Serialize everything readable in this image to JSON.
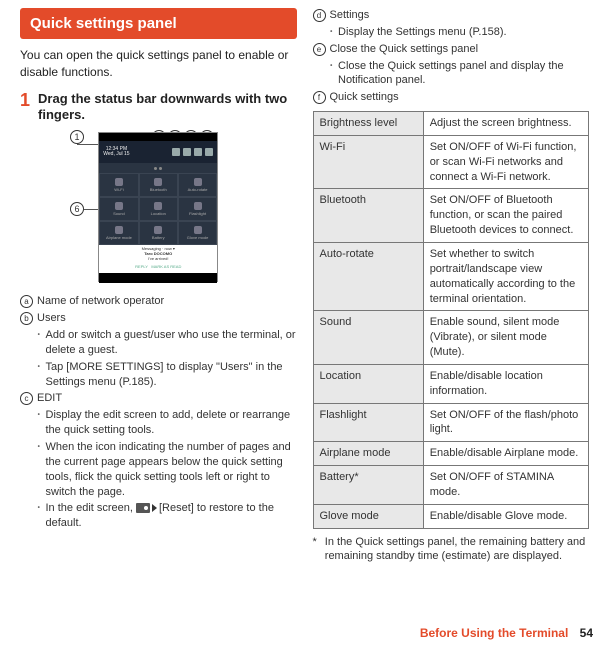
{
  "header": {
    "title": "Quick settings panel"
  },
  "intro": "You can open the quick settings panel to enable or disable functions.",
  "step": {
    "num": "1",
    "text": "Drag the status bar downwards with two fingers."
  },
  "screenshot": {
    "time": "12:34 PM",
    "date": "Wed, Jul 15",
    "tiles": [
      "Wi-Fi",
      "Bluetooth",
      "Auto-rotate",
      "Sound",
      "Location",
      "Flashlight",
      "Airplane mode",
      "Battery",
      "Glove mode"
    ],
    "notif_app": "Messaging · now ▾",
    "notif_sender": "Taro DOCOMO",
    "notif_body": "I've arrived!",
    "notif_reply": "REPLY",
    "notif_mark": "MARK AS READ"
  },
  "callouts": {
    "c1": "1",
    "c2": "2",
    "c3": "3",
    "c4": "4",
    "c5": "5",
    "c6": "6"
  },
  "leftList": {
    "i1": {
      "num": "a",
      "text": "Name of network operator"
    },
    "i2": {
      "num": "b",
      "text": "Users",
      "subs": [
        "Add or switch a guest/user who use the terminal, or delete a guest.",
        "Tap [MORE SETTINGS] to display \"Users\" in the Settings menu (P.185)."
      ]
    },
    "i3": {
      "num": "c",
      "text": "EDIT",
      "subs": [
        "Display the edit screen to add, delete or rearrange the quick setting tools.",
        "When the icon indicating the number of pages and the current page appears below the quick setting tools, flick the quick setting tools left or right to switch the page.",
        "In the edit screen,  [Reset] to restore to the default."
      ]
    }
  },
  "rightList": {
    "i4": {
      "num": "d",
      "text": "Settings",
      "subs": [
        "Display the Settings menu (P.158)."
      ]
    },
    "i5": {
      "num": "e",
      "text": "Close the Quick settings panel",
      "subs": [
        "Close the Quick settings panel and display the Notification panel."
      ]
    },
    "i6": {
      "num": "f",
      "text": "Quick settings"
    }
  },
  "table": [
    {
      "label": "Brightness level",
      "desc": "Adjust the screen brightness."
    },
    {
      "label": "Wi-Fi",
      "desc": "Set ON/OFF of Wi-Fi function, or scan Wi-Fi networks and connect a Wi-Fi network."
    },
    {
      "label": "Bluetooth",
      "desc": "Set ON/OFF of Bluetooth function, or scan the paired Bluetooth devices to connect."
    },
    {
      "label": "Auto-rotate",
      "desc": "Set whether to switch portrait/landscape view automatically according to the terminal orientation."
    },
    {
      "label": "Sound",
      "desc": "Enable sound, silent mode (Vibrate), or silent mode (Mute)."
    },
    {
      "label": "Location",
      "desc": "Enable/disable location information."
    },
    {
      "label": "Flashlight",
      "desc": "Set ON/OFF of the flash/photo light."
    },
    {
      "label": "Airplane mode",
      "desc": "Enable/disable Airplane mode."
    },
    {
      "label": "Battery*",
      "desc": "Set ON/OFF of STAMINA mode."
    },
    {
      "label": "Glove mode",
      "desc": "Enable/disable Glove mode."
    }
  ],
  "footnote": "In the Quick settings panel, the remaining battery and remaining standby time (estimate) are displayed.",
  "footer": {
    "section": "Before Using the Terminal",
    "page": "54"
  }
}
